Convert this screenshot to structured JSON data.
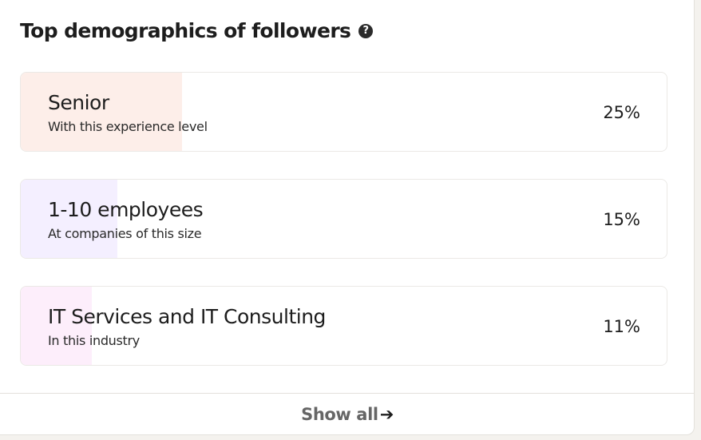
{
  "title": "Top demographics of followers",
  "icons": {
    "help": "question-circle-icon",
    "arrow": "arrow-right-icon"
  },
  "demographics": [
    {
      "label": "Senior",
      "sub": "With this experience level",
      "percent_text": "25%",
      "share": 0.25,
      "fill_color": "#fdeee9"
    },
    {
      "label": "1-10 employees",
      "sub": "At companies of this size",
      "percent_text": "15%",
      "share": 0.15,
      "fill_color": "#f4efff"
    },
    {
      "label": "IT Services and IT Consulting",
      "sub": "In this industry",
      "percent_text": "11%",
      "share": 0.11,
      "fill_color": "#fdeefb"
    }
  ],
  "footer": {
    "show_all_label": "Show all",
    "arrow_glyph": "➔"
  }
}
